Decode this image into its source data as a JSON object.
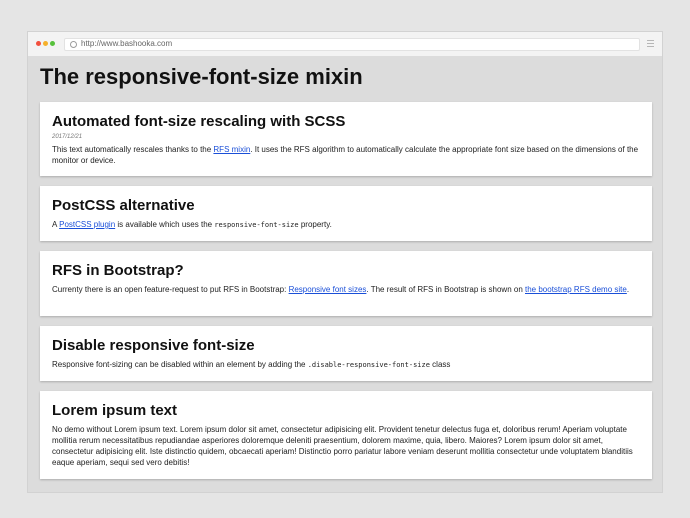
{
  "browser": {
    "url": "http://www.bashooka.com"
  },
  "page": {
    "title": "The responsive-font-size mixin"
  },
  "cards": [
    {
      "heading": "Automated font-size rescaling with SCSS",
      "date": "2017/12/21",
      "text1": "This text automatically rescales thanks to the ",
      "link1": "RFS mixin",
      "text2": ". It uses the RFS algorithm to automatically calculate the appropriate font size based on the dimensions of the monitor or device."
    },
    {
      "heading": "PostCSS alternative",
      "text1": "A ",
      "link1": "PostCSS plugin",
      "text2": " is available which uses the ",
      "code": "responsive-font-size",
      "text3": " property."
    },
    {
      "heading": "RFS in Bootstrap?",
      "text1": "Currenty there is an open feature-request to put RFS in Bootstrap: ",
      "link1": "Responsive font sizes",
      "text2": ". The result of RFS in Bootstrap is shown on ",
      "link2": "the bootstrap RFS demo site",
      "text3": "."
    },
    {
      "heading": "Disable responsive font-size",
      "text1": "Responsive font-sizing can be disabled within an element by adding the ",
      "code": ".disable-responsive-font-size",
      "text2": " class"
    },
    {
      "heading": "Lorem ipsum text",
      "body": "No demo without Lorem ipsum text. Lorem ipsum dolor sit amet, consectetur adipisicing elit. Provident tenetur delectus fuga et, doloribus rerum! Aperiam voluptate mollitia rerum necessitatibus repudiandae asperiores doloremque deleniti praesentium, dolorem maxime, quia, libero. Maiores? Lorem ipsum dolor sit amet, consectetur adipisicing elit. Iste distinctio quidem, obcaecati aperiam! Distinctio porro pariatur labore veniam deserunt mollitia consectetur unde voluptatem blanditiis eaque aperiam, sequi sed vero debitis!"
    }
  ]
}
